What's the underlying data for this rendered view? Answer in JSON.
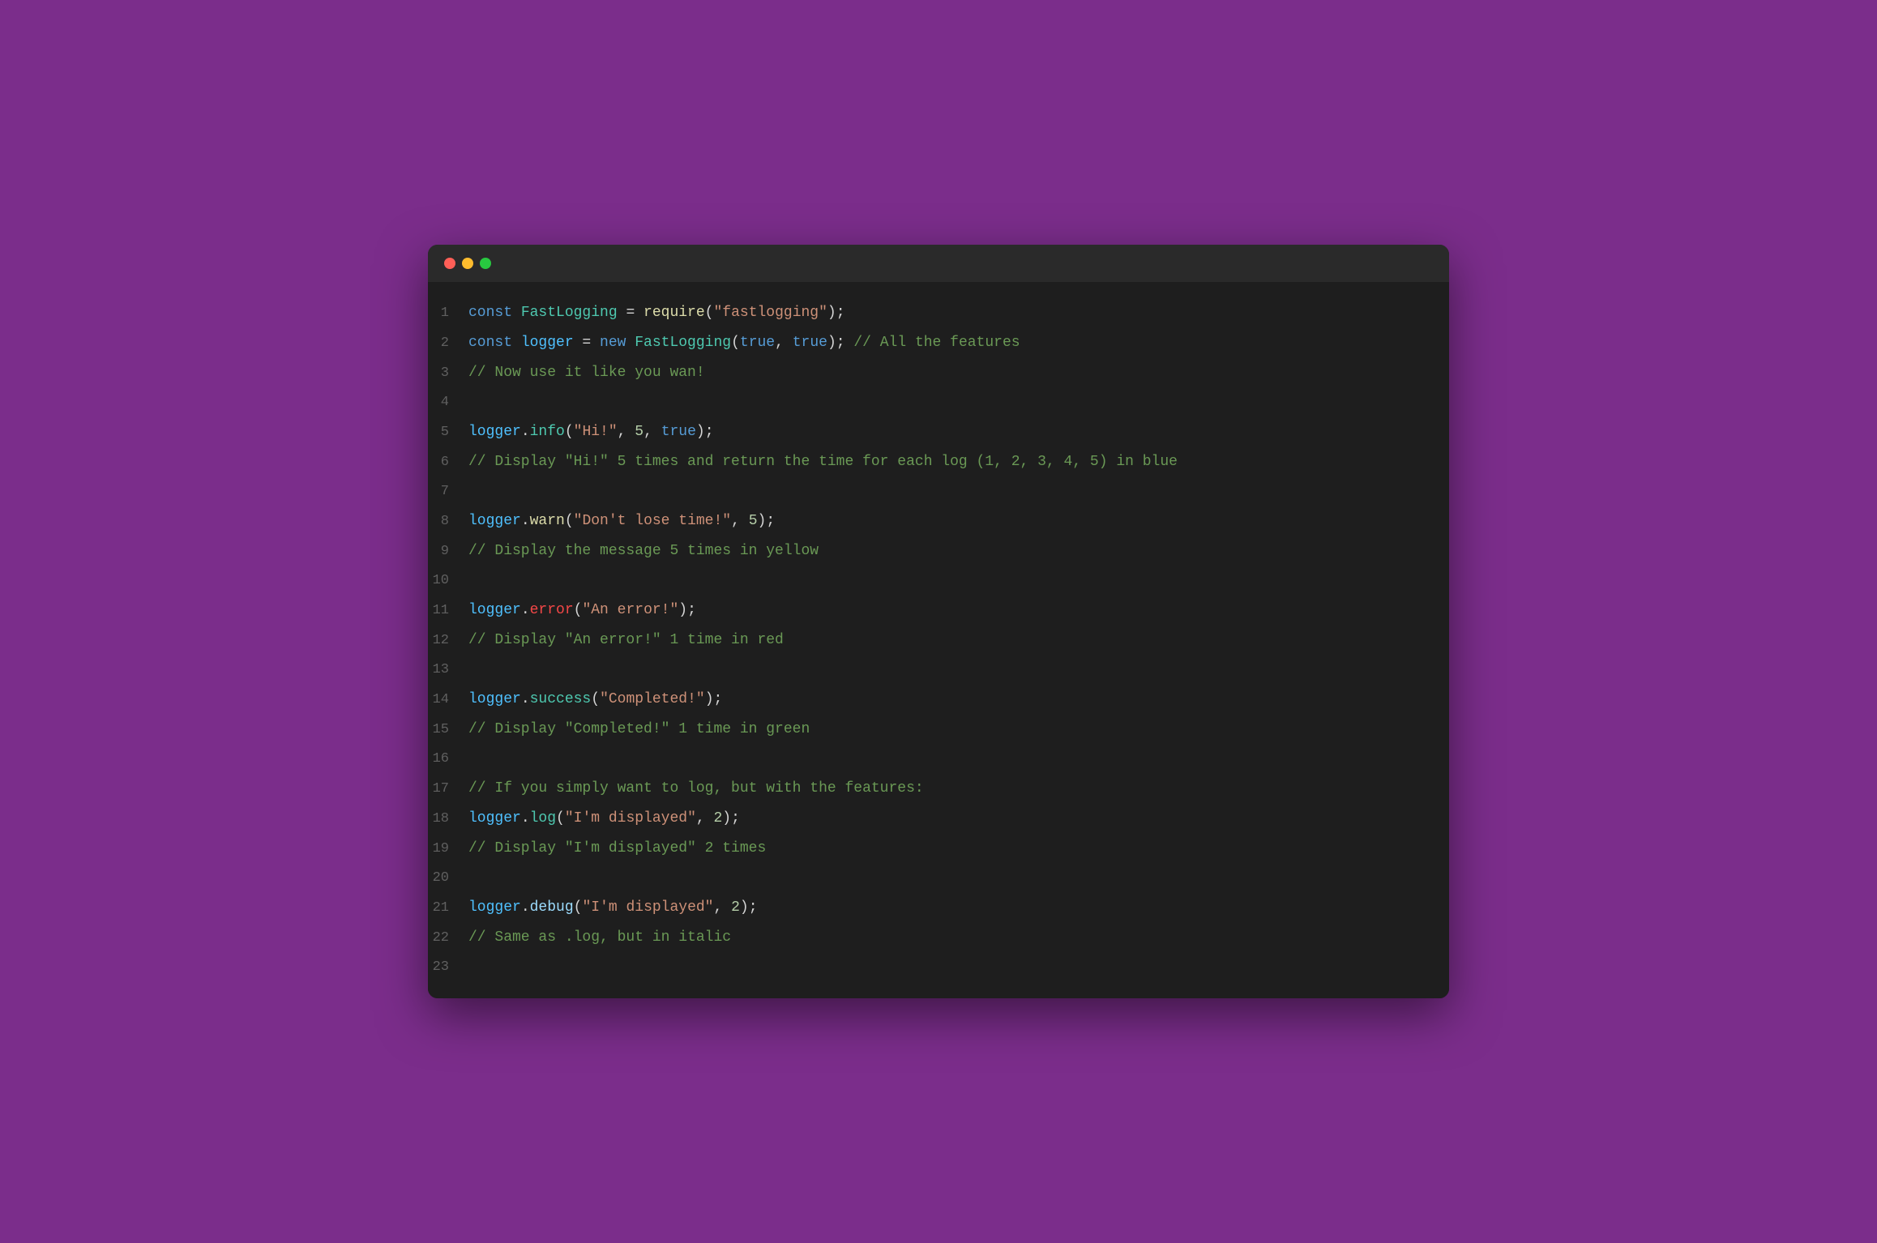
{
  "window": {
    "titlebar": {
      "dot_red": "close",
      "dot_yellow": "minimize",
      "dot_green": "maximize"
    }
  },
  "code": {
    "lines": [
      {
        "num": "1",
        "tokens": [
          {
            "type": "kw",
            "text": "const "
          },
          {
            "type": "id-blue",
            "text": "FastLogging"
          },
          {
            "type": "op",
            "text": " = "
          },
          {
            "type": "fn",
            "text": "require"
          },
          {
            "type": "punc",
            "text": "("
          },
          {
            "type": "str",
            "text": "\"fastlogging\""
          },
          {
            "type": "punc",
            "text": ");"
          }
        ]
      },
      {
        "num": "2",
        "tokens": [
          {
            "type": "kw",
            "text": "const "
          },
          {
            "type": "logger-id",
            "text": "logger"
          },
          {
            "type": "op",
            "text": " = "
          },
          {
            "type": "kw",
            "text": "new "
          },
          {
            "type": "id-blue",
            "text": "FastLogging"
          },
          {
            "type": "punc",
            "text": "("
          },
          {
            "type": "bool",
            "text": "true"
          },
          {
            "type": "punc",
            "text": ", "
          },
          {
            "type": "bool",
            "text": "true"
          },
          {
            "type": "punc",
            "text": "); "
          },
          {
            "type": "comment",
            "text": "// All the features"
          }
        ]
      },
      {
        "num": "3",
        "tokens": [
          {
            "type": "comment",
            "text": "// Now use it like you wan!"
          }
        ]
      },
      {
        "num": "4",
        "tokens": []
      },
      {
        "num": "5",
        "tokens": [
          {
            "type": "logger-id",
            "text": "logger"
          },
          {
            "type": "punc",
            "text": "."
          },
          {
            "type": "method-info",
            "text": "info"
          },
          {
            "type": "punc",
            "text": "("
          },
          {
            "type": "str",
            "text": "\"Hi!\""
          },
          {
            "type": "punc",
            "text": ", "
          },
          {
            "type": "num",
            "text": "5"
          },
          {
            "type": "punc",
            "text": ", "
          },
          {
            "type": "bool",
            "text": "true"
          },
          {
            "type": "punc",
            "text": ");"
          }
        ]
      },
      {
        "num": "6",
        "tokens": [
          {
            "type": "comment",
            "text": "// Display \"Hi!\" 5 times and return the time for each log (1, 2, 3, 4, 5) in blue"
          }
        ]
      },
      {
        "num": "7",
        "tokens": []
      },
      {
        "num": "8",
        "tokens": [
          {
            "type": "logger-id",
            "text": "logger"
          },
          {
            "type": "punc",
            "text": "."
          },
          {
            "type": "method-warn",
            "text": "warn"
          },
          {
            "type": "punc",
            "text": "("
          },
          {
            "type": "str",
            "text": "\"Don't lose time!\""
          },
          {
            "type": "punc",
            "text": ", "
          },
          {
            "type": "num",
            "text": "5"
          },
          {
            "type": "punc",
            "text": ");"
          }
        ]
      },
      {
        "num": "9",
        "tokens": [
          {
            "type": "comment",
            "text": "// Display the message 5 times in yellow"
          }
        ]
      },
      {
        "num": "10",
        "tokens": []
      },
      {
        "num": "11",
        "tokens": [
          {
            "type": "logger-id",
            "text": "logger"
          },
          {
            "type": "punc",
            "text": "."
          },
          {
            "type": "method-error",
            "text": "error"
          },
          {
            "type": "punc",
            "text": "("
          },
          {
            "type": "str",
            "text": "\"An error!\""
          },
          {
            "type": "punc",
            "text": ");"
          }
        ]
      },
      {
        "num": "12",
        "tokens": [
          {
            "type": "comment",
            "text": "// Display \"An error!\" 1 time in red"
          }
        ]
      },
      {
        "num": "13",
        "tokens": []
      },
      {
        "num": "14",
        "tokens": [
          {
            "type": "logger-id",
            "text": "logger"
          },
          {
            "type": "punc",
            "text": "."
          },
          {
            "type": "method-success",
            "text": "success"
          },
          {
            "type": "punc",
            "text": "("
          },
          {
            "type": "str",
            "text": "\"Completed!\""
          },
          {
            "type": "punc",
            "text": ");"
          }
        ]
      },
      {
        "num": "15",
        "tokens": [
          {
            "type": "comment",
            "text": "// Display \"Completed!\" 1 time in green"
          }
        ]
      },
      {
        "num": "16",
        "tokens": []
      },
      {
        "num": "17",
        "tokens": [
          {
            "type": "comment",
            "text": "// If you simply want to log, but with the features:"
          }
        ]
      },
      {
        "num": "18",
        "tokens": [
          {
            "type": "logger-id",
            "text": "logger"
          },
          {
            "type": "punc",
            "text": "."
          },
          {
            "type": "method-log",
            "text": "log"
          },
          {
            "type": "punc",
            "text": "("
          },
          {
            "type": "str",
            "text": "\"I'm displayed\""
          },
          {
            "type": "punc",
            "text": ", "
          },
          {
            "type": "num",
            "text": "2"
          },
          {
            "type": "punc",
            "text": ");"
          }
        ]
      },
      {
        "num": "19",
        "tokens": [
          {
            "type": "comment",
            "text": "// Display \"I'm displayed\" 2 times"
          }
        ]
      },
      {
        "num": "20",
        "tokens": []
      },
      {
        "num": "21",
        "tokens": [
          {
            "type": "logger-id",
            "text": "logger"
          },
          {
            "type": "punc",
            "text": "."
          },
          {
            "type": "method-debug",
            "text": "debug"
          },
          {
            "type": "punc",
            "text": "("
          },
          {
            "type": "str",
            "text": "\"I'm displayed\""
          },
          {
            "type": "punc",
            "text": ", "
          },
          {
            "type": "num",
            "text": "2"
          },
          {
            "type": "punc",
            "text": ");"
          }
        ]
      },
      {
        "num": "22",
        "tokens": [
          {
            "type": "comment",
            "text": "// Same as .log, but in italic"
          }
        ]
      },
      {
        "num": "23",
        "tokens": []
      }
    ]
  }
}
